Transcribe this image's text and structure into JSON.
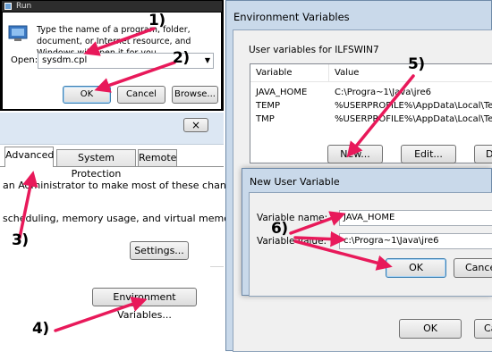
{
  "run": {
    "title": "Run",
    "description": "Type the name of a program, folder, document, or Internet resource, and Windows will open it for you.",
    "open_label": "Open:",
    "open_value": "sysdm.cpl",
    "ok": "OK",
    "cancel": "Cancel",
    "browse": "Browse..."
  },
  "system_properties": {
    "close_glyph": "×",
    "tabs": [
      "Advanced",
      "System Protection",
      "Remote"
    ],
    "admin_text": "an Administrator to make most of these changes.",
    "perf_text": "scheduling, memory usage, and virtual memory",
    "settings": "Settings...",
    "env_vars": "Environment Variables..."
  },
  "env_vars": {
    "title": "Environment Variables",
    "user_vars_label": "User variables for ILFSWIN7",
    "col_variable": "Variable",
    "col_value": "Value",
    "rows": [
      {
        "variable": "JAVA_HOME",
        "value": "C:\\Progra~1\\Java\\jre6"
      },
      {
        "variable": "TEMP",
        "value": "%USERPROFILE%\\AppData\\Local\\Temp"
      },
      {
        "variable": "TMP",
        "value": "%USERPROFILE%\\AppData\\Local\\Temp"
      }
    ],
    "new": "New...",
    "edit": "Edit...",
    "delete": "Delet",
    "ok": "OK",
    "cancel": "Ca"
  },
  "new_user_var": {
    "title": "New User Variable",
    "name_label": "Variable name:",
    "name_value": "JAVA_HOME",
    "value_label": "Variable value:",
    "value_value": "c:\\Progra~1\\Java\\jre6",
    "ok": "OK",
    "cancel": "Cance"
  },
  "callouts": [
    "1)",
    "2)",
    "3)",
    "4)",
    "5)",
    "6)"
  ],
  "colors": {
    "arrow": "#e8195a",
    "dialog_frame": "#c9d9ea",
    "titlebar": "#b7cde3"
  }
}
